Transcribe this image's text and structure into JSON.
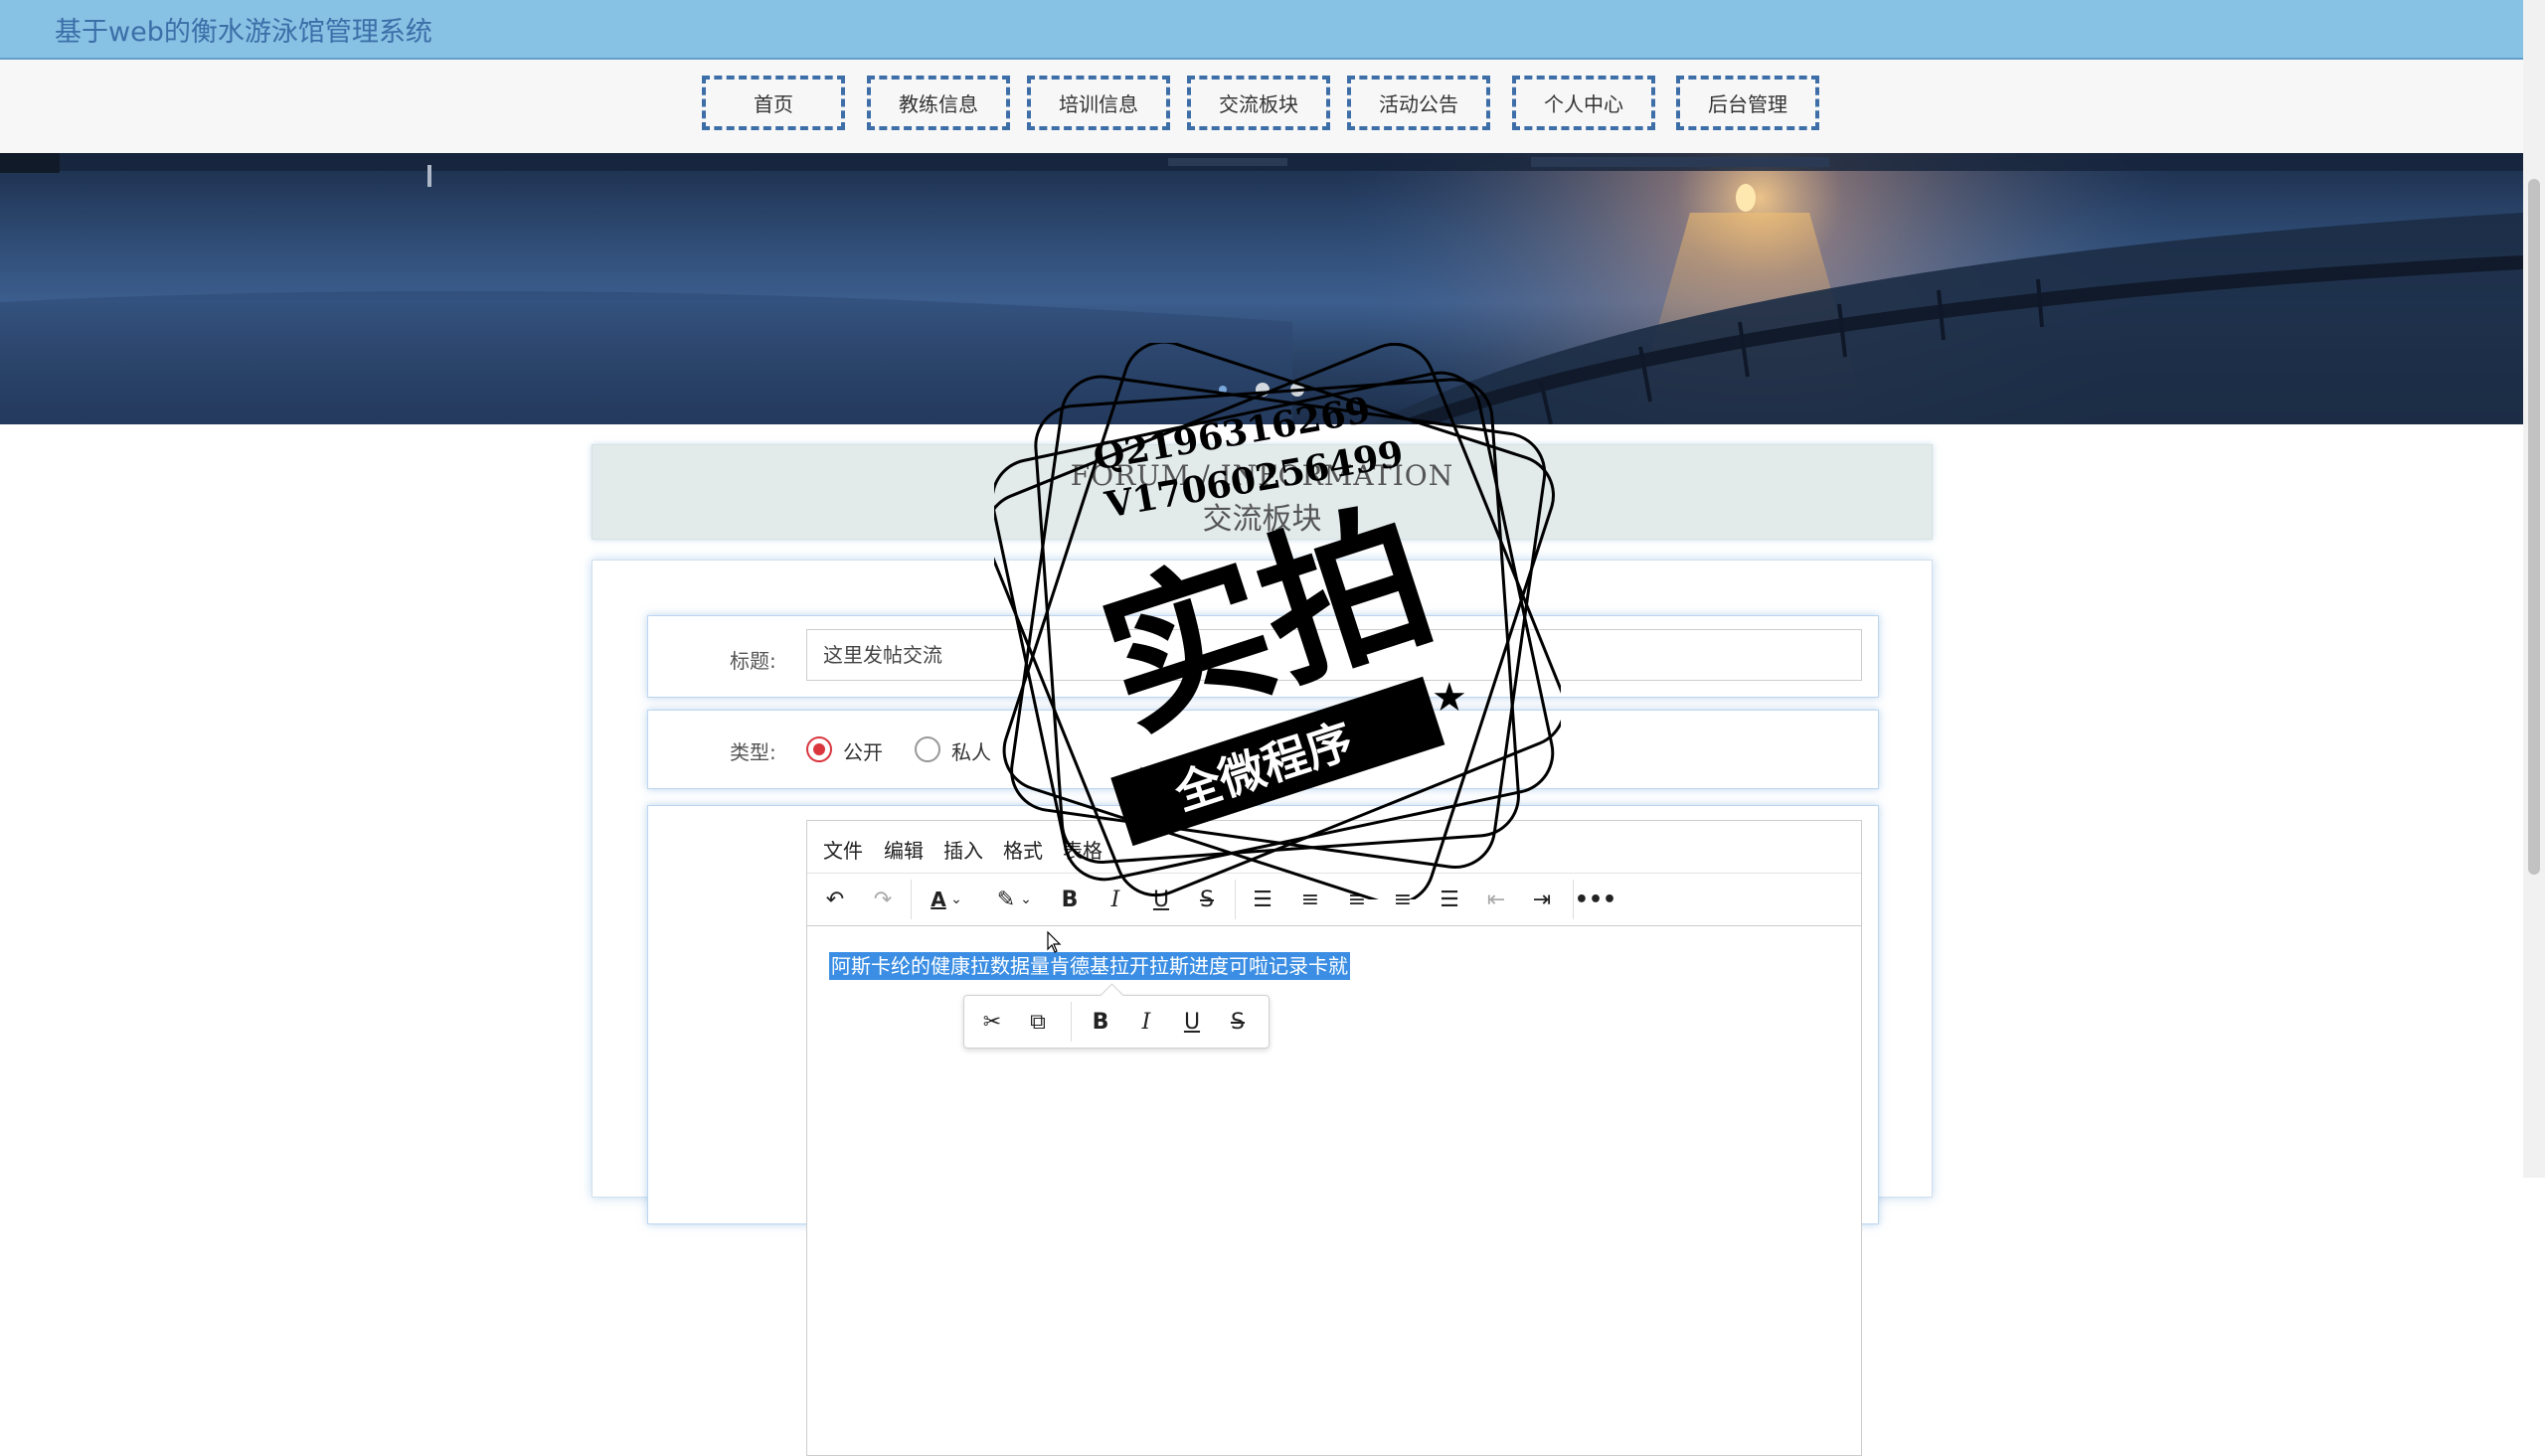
{
  "header": {
    "title": "基于web的衡水游泳馆管理系统"
  },
  "nav": {
    "items": [
      {
        "label": "首页"
      },
      {
        "label": "教练信息"
      },
      {
        "label": "培训信息"
      },
      {
        "label": "交流板块"
      },
      {
        "label": "活动公告"
      },
      {
        "label": "个人中心"
      },
      {
        "label": "后台管理"
      }
    ]
  },
  "section": {
    "title_en": "FORUM / INFORMATION",
    "title_cn": "交流板块"
  },
  "form": {
    "title_label": "标题:",
    "title_value": "这里发帖交流",
    "type_label": "类型:",
    "type_options": [
      {
        "label": "公开",
        "selected": true
      },
      {
        "label": "私人",
        "selected": false
      }
    ]
  },
  "editor": {
    "menu": [
      "文件",
      "编辑",
      "插入",
      "格式",
      "表格"
    ],
    "content": "阿斯卡纶的健康拉数据量肯德基拉开拉斯进度可啦记录卡就"
  },
  "watermark": {
    "line1": "Q2196316269",
    "line2": "V17060256499",
    "main": "实拍",
    "ribbon": "全微程序"
  },
  "colors": {
    "header_bg": "#87c1e3",
    "nav_border": "#3d6ea8",
    "selection": "#3b8ee3",
    "radio_active": "#d9363e"
  }
}
